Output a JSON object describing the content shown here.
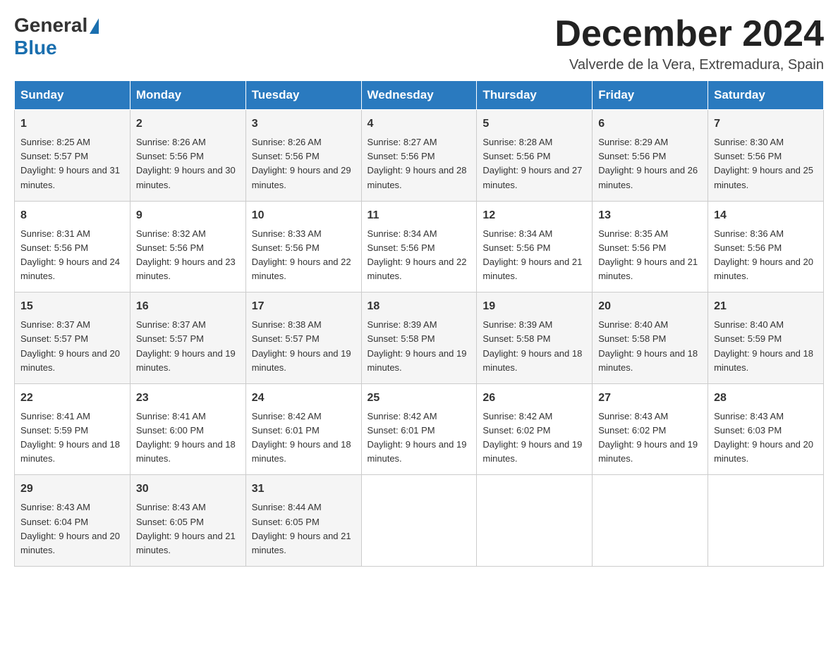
{
  "logo": {
    "general": "General",
    "blue": "Blue"
  },
  "header": {
    "month": "December 2024",
    "location": "Valverde de la Vera, Extremadura, Spain"
  },
  "weekdays": [
    "Sunday",
    "Monday",
    "Tuesday",
    "Wednesday",
    "Thursday",
    "Friday",
    "Saturday"
  ],
  "weeks": [
    [
      {
        "day": "1",
        "sunrise": "8:25 AM",
        "sunset": "5:57 PM",
        "daylight": "9 hours and 31 minutes."
      },
      {
        "day": "2",
        "sunrise": "8:26 AM",
        "sunset": "5:56 PM",
        "daylight": "9 hours and 30 minutes."
      },
      {
        "day": "3",
        "sunrise": "8:26 AM",
        "sunset": "5:56 PM",
        "daylight": "9 hours and 29 minutes."
      },
      {
        "day": "4",
        "sunrise": "8:27 AM",
        "sunset": "5:56 PM",
        "daylight": "9 hours and 28 minutes."
      },
      {
        "day": "5",
        "sunrise": "8:28 AM",
        "sunset": "5:56 PM",
        "daylight": "9 hours and 27 minutes."
      },
      {
        "day": "6",
        "sunrise": "8:29 AM",
        "sunset": "5:56 PM",
        "daylight": "9 hours and 26 minutes."
      },
      {
        "day": "7",
        "sunrise": "8:30 AM",
        "sunset": "5:56 PM",
        "daylight": "9 hours and 25 minutes."
      }
    ],
    [
      {
        "day": "8",
        "sunrise": "8:31 AM",
        "sunset": "5:56 PM",
        "daylight": "9 hours and 24 minutes."
      },
      {
        "day": "9",
        "sunrise": "8:32 AM",
        "sunset": "5:56 PM",
        "daylight": "9 hours and 23 minutes."
      },
      {
        "day": "10",
        "sunrise": "8:33 AM",
        "sunset": "5:56 PM",
        "daylight": "9 hours and 22 minutes."
      },
      {
        "day": "11",
        "sunrise": "8:34 AM",
        "sunset": "5:56 PM",
        "daylight": "9 hours and 22 minutes."
      },
      {
        "day": "12",
        "sunrise": "8:34 AM",
        "sunset": "5:56 PM",
        "daylight": "9 hours and 21 minutes."
      },
      {
        "day": "13",
        "sunrise": "8:35 AM",
        "sunset": "5:56 PM",
        "daylight": "9 hours and 21 minutes."
      },
      {
        "day": "14",
        "sunrise": "8:36 AM",
        "sunset": "5:56 PM",
        "daylight": "9 hours and 20 minutes."
      }
    ],
    [
      {
        "day": "15",
        "sunrise": "8:37 AM",
        "sunset": "5:57 PM",
        "daylight": "9 hours and 20 minutes."
      },
      {
        "day": "16",
        "sunrise": "8:37 AM",
        "sunset": "5:57 PM",
        "daylight": "9 hours and 19 minutes."
      },
      {
        "day": "17",
        "sunrise": "8:38 AM",
        "sunset": "5:57 PM",
        "daylight": "9 hours and 19 minutes."
      },
      {
        "day": "18",
        "sunrise": "8:39 AM",
        "sunset": "5:58 PM",
        "daylight": "9 hours and 19 minutes."
      },
      {
        "day": "19",
        "sunrise": "8:39 AM",
        "sunset": "5:58 PM",
        "daylight": "9 hours and 18 minutes."
      },
      {
        "day": "20",
        "sunrise": "8:40 AM",
        "sunset": "5:58 PM",
        "daylight": "9 hours and 18 minutes."
      },
      {
        "day": "21",
        "sunrise": "8:40 AM",
        "sunset": "5:59 PM",
        "daylight": "9 hours and 18 minutes."
      }
    ],
    [
      {
        "day": "22",
        "sunrise": "8:41 AM",
        "sunset": "5:59 PM",
        "daylight": "9 hours and 18 minutes."
      },
      {
        "day": "23",
        "sunrise": "8:41 AM",
        "sunset": "6:00 PM",
        "daylight": "9 hours and 18 minutes."
      },
      {
        "day": "24",
        "sunrise": "8:42 AM",
        "sunset": "6:01 PM",
        "daylight": "9 hours and 18 minutes."
      },
      {
        "day": "25",
        "sunrise": "8:42 AM",
        "sunset": "6:01 PM",
        "daylight": "9 hours and 19 minutes."
      },
      {
        "day": "26",
        "sunrise": "8:42 AM",
        "sunset": "6:02 PM",
        "daylight": "9 hours and 19 minutes."
      },
      {
        "day": "27",
        "sunrise": "8:43 AM",
        "sunset": "6:02 PM",
        "daylight": "9 hours and 19 minutes."
      },
      {
        "day": "28",
        "sunrise": "8:43 AM",
        "sunset": "6:03 PM",
        "daylight": "9 hours and 20 minutes."
      }
    ],
    [
      {
        "day": "29",
        "sunrise": "8:43 AM",
        "sunset": "6:04 PM",
        "daylight": "9 hours and 20 minutes."
      },
      {
        "day": "30",
        "sunrise": "8:43 AM",
        "sunset": "6:05 PM",
        "daylight": "9 hours and 21 minutes."
      },
      {
        "day": "31",
        "sunrise": "8:44 AM",
        "sunset": "6:05 PM",
        "daylight": "9 hours and 21 minutes."
      },
      null,
      null,
      null,
      null
    ]
  ]
}
